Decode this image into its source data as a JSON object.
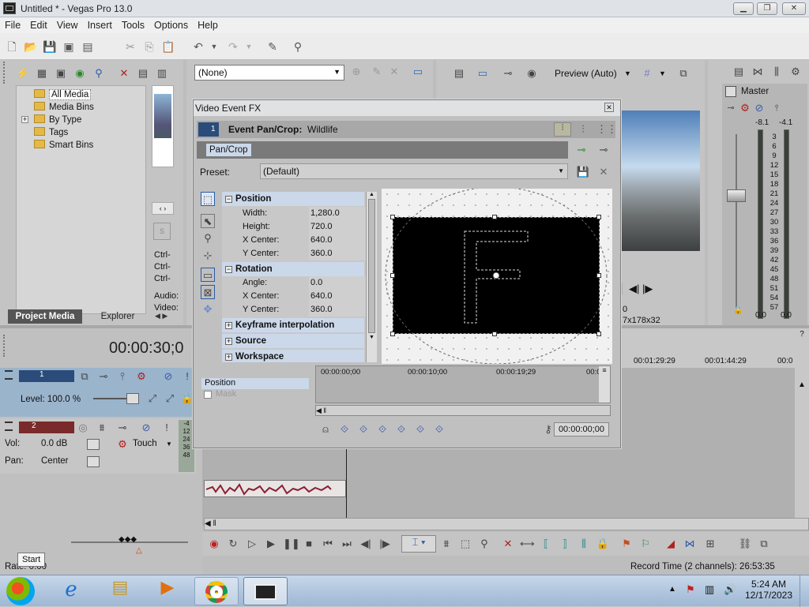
{
  "window": {
    "title": "Untitled * - Vegas Pro 13.0",
    "min": "▁",
    "max": "❐",
    "close": "✕"
  },
  "menu": [
    "File",
    "Edit",
    "View",
    "Insert",
    "Tools",
    "Options",
    "Help"
  ],
  "project_media": {
    "tree": [
      "All Media",
      "Media Bins",
      "By Type",
      "Tags",
      "Smart Bins"
    ],
    "expander": "+",
    "tabs": [
      "Project Media",
      "Explorer"
    ],
    "side_labels": [
      "Ctrl-",
      "Ctrl-",
      "Ctrl-",
      "Audio:",
      "Video:"
    ]
  },
  "preview_dropdown": "(None)",
  "video_preview": {
    "mode": "Preview (Auto)",
    "footer": "7x178x32",
    "frame": "0"
  },
  "master": {
    "label": "Master",
    "left_peak": "-8.1",
    "right_peak": "-4.1",
    "scale": [
      "3",
      "6",
      "9",
      "12",
      "15",
      "18",
      "21",
      "24",
      "27",
      "30",
      "33",
      "36",
      "39",
      "42",
      "45",
      "48",
      "51",
      "54",
      "57"
    ],
    "left_val": "0.0",
    "right_val": "0.0"
  },
  "timecode": "00:00:30;0",
  "track1": {
    "num": "1",
    "level": "Level: 100.0 %"
  },
  "track2": {
    "num": "2",
    "vol_label": "Vol:",
    "vol_val": "0.0 dB",
    "pan_label": "Pan:",
    "pan_val": "Center",
    "touch": "Touch",
    "meter": [
      "-4",
      "12",
      "24",
      "36",
      "48"
    ]
  },
  "ruler": [
    "00:01:29:29",
    "00:01:44:29",
    "00:0"
  ],
  "rate": "Rate: 0.00",
  "start_tooltip": "Start",
  "record_time": "Record Time (2 channels): 26:53:35",
  "dialog": {
    "title": "Video Event FX",
    "chain_num": "1",
    "event_label": "Event Pan/Crop:",
    "event_name": "Wildlife",
    "plugin": "Pan/Crop",
    "preset_label": "Preset:",
    "preset_value": "(Default)",
    "sections": {
      "position": "Position",
      "rotation": "Rotation",
      "keyframe": "Keyframe interpolation",
      "source": "Source",
      "workspace": "Workspace"
    },
    "position_rows": [
      [
        "Width:",
        "1,280.0"
      ],
      [
        "Height:",
        "720.0"
      ],
      [
        "X Center:",
        "640.0"
      ],
      [
        "Y Center:",
        "360.0"
      ]
    ],
    "rotation_rows": [
      [
        "Angle:",
        "0.0"
      ],
      [
        "X Center:",
        "640.0"
      ],
      [
        "Y Center:",
        "360.0"
      ]
    ],
    "kf_tracks": [
      "Position",
      "Mask"
    ],
    "kf_ruler": [
      "00:00:00;00",
      "00:00:10;00",
      "00:00:19;29",
      "00:0"
    ],
    "kf_time": "00:00:00;00"
  },
  "clock": {
    "time": "5:24 AM",
    "date": "12/17/2023"
  }
}
